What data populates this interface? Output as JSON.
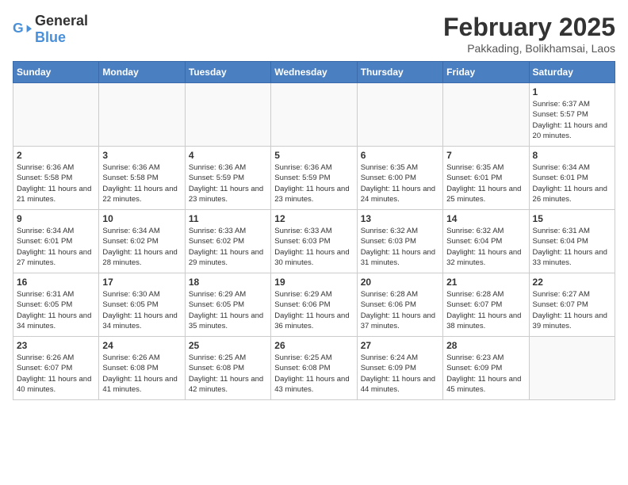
{
  "header": {
    "logo_general": "General",
    "logo_blue": "Blue",
    "month_title": "February 2025",
    "location": "Pakkading, Bolikhamsai, Laos"
  },
  "days_of_week": [
    "Sunday",
    "Monday",
    "Tuesday",
    "Wednesday",
    "Thursday",
    "Friday",
    "Saturday"
  ],
  "weeks": [
    [
      {
        "day": "",
        "info": ""
      },
      {
        "day": "",
        "info": ""
      },
      {
        "day": "",
        "info": ""
      },
      {
        "day": "",
        "info": ""
      },
      {
        "day": "",
        "info": ""
      },
      {
        "day": "",
        "info": ""
      },
      {
        "day": "1",
        "info": "Sunrise: 6:37 AM\nSunset: 5:57 PM\nDaylight: 11 hours and 20 minutes."
      }
    ],
    [
      {
        "day": "2",
        "info": "Sunrise: 6:36 AM\nSunset: 5:58 PM\nDaylight: 11 hours and 21 minutes."
      },
      {
        "day": "3",
        "info": "Sunrise: 6:36 AM\nSunset: 5:58 PM\nDaylight: 11 hours and 22 minutes."
      },
      {
        "day": "4",
        "info": "Sunrise: 6:36 AM\nSunset: 5:59 PM\nDaylight: 11 hours and 23 minutes."
      },
      {
        "day": "5",
        "info": "Sunrise: 6:36 AM\nSunset: 5:59 PM\nDaylight: 11 hours and 23 minutes."
      },
      {
        "day": "6",
        "info": "Sunrise: 6:35 AM\nSunset: 6:00 PM\nDaylight: 11 hours and 24 minutes."
      },
      {
        "day": "7",
        "info": "Sunrise: 6:35 AM\nSunset: 6:01 PM\nDaylight: 11 hours and 25 minutes."
      },
      {
        "day": "8",
        "info": "Sunrise: 6:34 AM\nSunset: 6:01 PM\nDaylight: 11 hours and 26 minutes."
      }
    ],
    [
      {
        "day": "9",
        "info": "Sunrise: 6:34 AM\nSunset: 6:01 PM\nDaylight: 11 hours and 27 minutes."
      },
      {
        "day": "10",
        "info": "Sunrise: 6:34 AM\nSunset: 6:02 PM\nDaylight: 11 hours and 28 minutes."
      },
      {
        "day": "11",
        "info": "Sunrise: 6:33 AM\nSunset: 6:02 PM\nDaylight: 11 hours and 29 minutes."
      },
      {
        "day": "12",
        "info": "Sunrise: 6:33 AM\nSunset: 6:03 PM\nDaylight: 11 hours and 30 minutes."
      },
      {
        "day": "13",
        "info": "Sunrise: 6:32 AM\nSunset: 6:03 PM\nDaylight: 11 hours and 31 minutes."
      },
      {
        "day": "14",
        "info": "Sunrise: 6:32 AM\nSunset: 6:04 PM\nDaylight: 11 hours and 32 minutes."
      },
      {
        "day": "15",
        "info": "Sunrise: 6:31 AM\nSunset: 6:04 PM\nDaylight: 11 hours and 33 minutes."
      }
    ],
    [
      {
        "day": "16",
        "info": "Sunrise: 6:31 AM\nSunset: 6:05 PM\nDaylight: 11 hours and 34 minutes."
      },
      {
        "day": "17",
        "info": "Sunrise: 6:30 AM\nSunset: 6:05 PM\nDaylight: 11 hours and 34 minutes."
      },
      {
        "day": "18",
        "info": "Sunrise: 6:29 AM\nSunset: 6:05 PM\nDaylight: 11 hours and 35 minutes."
      },
      {
        "day": "19",
        "info": "Sunrise: 6:29 AM\nSunset: 6:06 PM\nDaylight: 11 hours and 36 minutes."
      },
      {
        "day": "20",
        "info": "Sunrise: 6:28 AM\nSunset: 6:06 PM\nDaylight: 11 hours and 37 minutes."
      },
      {
        "day": "21",
        "info": "Sunrise: 6:28 AM\nSunset: 6:07 PM\nDaylight: 11 hours and 38 minutes."
      },
      {
        "day": "22",
        "info": "Sunrise: 6:27 AM\nSunset: 6:07 PM\nDaylight: 11 hours and 39 minutes."
      }
    ],
    [
      {
        "day": "23",
        "info": "Sunrise: 6:26 AM\nSunset: 6:07 PM\nDaylight: 11 hours and 40 minutes."
      },
      {
        "day": "24",
        "info": "Sunrise: 6:26 AM\nSunset: 6:08 PM\nDaylight: 11 hours and 41 minutes."
      },
      {
        "day": "25",
        "info": "Sunrise: 6:25 AM\nSunset: 6:08 PM\nDaylight: 11 hours and 42 minutes."
      },
      {
        "day": "26",
        "info": "Sunrise: 6:25 AM\nSunset: 6:08 PM\nDaylight: 11 hours and 43 minutes."
      },
      {
        "day": "27",
        "info": "Sunrise: 6:24 AM\nSunset: 6:09 PM\nDaylight: 11 hours and 44 minutes."
      },
      {
        "day": "28",
        "info": "Sunrise: 6:23 AM\nSunset: 6:09 PM\nDaylight: 11 hours and 45 minutes."
      },
      {
        "day": "",
        "info": ""
      }
    ]
  ]
}
